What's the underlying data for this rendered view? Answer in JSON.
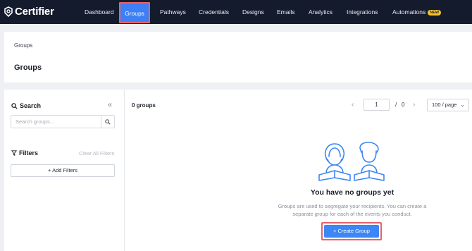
{
  "brand": {
    "name": "Certifier"
  },
  "nav": {
    "items": [
      {
        "label": "Dashboard"
      },
      {
        "label": "Groups"
      },
      {
        "label": "Pathways"
      },
      {
        "label": "Credentials"
      },
      {
        "label": "Designs"
      },
      {
        "label": "Emails"
      },
      {
        "label": "Analytics"
      },
      {
        "label": "Integrations"
      },
      {
        "label": "Automations",
        "badge": "NEW"
      }
    ],
    "active": "Groups"
  },
  "header": {
    "breadcrumb": "Groups",
    "title": "Groups"
  },
  "sidebar": {
    "search_title": "Search",
    "search_placeholder": "Search groups...",
    "filters_title": "Filters",
    "clear_filters": "Clear All Filters",
    "add_filters": "+  Add Filters"
  },
  "list": {
    "count": "0 groups",
    "page": "1",
    "separator": "/",
    "total_pages": "0",
    "page_size": "100 / page"
  },
  "empty_state": {
    "title": "You have no groups yet",
    "description": "Groups are used to segregate your recipients. You can create a separate group for each of the events you conduct.",
    "button": "+  Create Group"
  },
  "colors": {
    "nav_bg": "#141b2d",
    "accent": "#3d7ff4",
    "badge": "#f5c22b",
    "highlight": "#e8626a"
  }
}
